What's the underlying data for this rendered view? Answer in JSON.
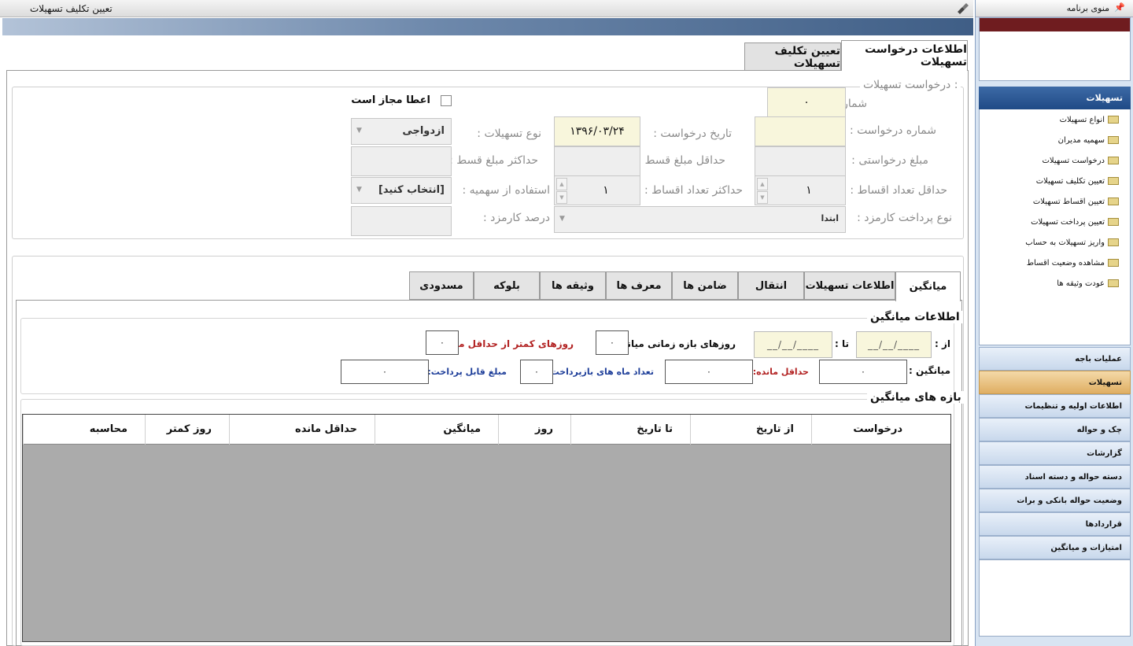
{
  "window": {
    "title": "تعیین تکلیف تسهیلات"
  },
  "outer_tabs": [
    "اطلاعات درخواست تسهیلات",
    "تعیین تکلیف تسهیلات"
  ],
  "request": {
    "group_title": "درخواست تسهیلات :",
    "grant_allowed_label": "اعطا مجاز است",
    "account_number_label": "شماره حساب :",
    "account_number_value": "۰",
    "request_number_label": "شماره درخواست :",
    "request_date_label": "تاریخ درخواست :",
    "request_date_value": "۱۳۹۶/۰۳/۲۴",
    "facility_type_label": "نوع تسهیلات :",
    "facility_type_value": "ازدواجی",
    "requested_amount_label": "مبلغ درخواستی :",
    "min_installment_label": "حداقل مبلغ قسط :",
    "max_installment_label": "حداکثر مبلغ قسط :",
    "min_count_label": "حداقل تعداد اقساط :",
    "min_count_value": "۱",
    "max_count_label": "حداکثر تعداد اقساط :",
    "max_count_value": "۱",
    "quota_label": "استفاده از سهمیه :",
    "quota_value": "[انتخاب کنید]",
    "fee_payment_label": "نوع پرداخت کارمزد :",
    "fee_payment_value": "ابتدا",
    "fee_percent_label": "درصد کارمزد :"
  },
  "inner_tabs": [
    "میانگین",
    "اطلاعات تسهیلات",
    "انتقال",
    "ضامن ها",
    "معرف ها",
    "وثیقه ها",
    "بلوکه",
    "مسدودی"
  ],
  "average": {
    "group_title": "اطلاعات میانگین",
    "from_label": "از :",
    "from_value": "__/__/____",
    "to_label": "تا :",
    "to_value": "__/__/____",
    "period_days_label": "روزهای بازه زمانی میانگین:",
    "period_days_value": "۰",
    "days_below_label": "روزهای کمتر از حداقل مانده:",
    "days_below_value": "۰",
    "average_label": "میانگین :",
    "average_value": "۰",
    "min_balance_label": "حداقل مانده:",
    "min_balance_value": "۰",
    "months_label": "تعداد ماه های بازپرداخت:",
    "months_value": "۰",
    "payable_label": "مبلغ قابل پرداخت:",
    "payable_value": "۰"
  },
  "ranges": {
    "group_title": "بازه های میانگین",
    "columns": [
      "درخواست",
      "از تاریخ",
      "تا تاریخ",
      "روز",
      "میانگین",
      "حداقل مانده",
      "روز کمتر",
      "محاسبه"
    ]
  },
  "nav": {
    "title": "منوی برنامه",
    "section_title": "تسهیلات",
    "tree": [
      "انواع تسهیلات",
      "سهمیه مدیران",
      "درخواست تسهیلات",
      "تعیین تکلیف تسهیلات",
      "تعیین اقساط تسهیلات",
      "تعیین پرداخت تسهیلات",
      "واریز تسهیلات به حساب",
      "مشاهده وضعیت اقساط",
      "عودت وثیقه ها"
    ],
    "buttons": [
      "عملیات باجه",
      "تسهیلات",
      "اطلاعات اولیه و تنظیمات",
      "چک و حواله",
      "گزارشات",
      "دسته حواله و دسته اسناد",
      "وضعیت حواله بانکی و برات",
      "قراردادها",
      "امتیازات و میانگین"
    ]
  },
  "colors": {
    "accent": "#3f5e86",
    "nav_selected": "#dfae62",
    "red_label": "#b22222",
    "blue_label": "#1f3f9a"
  }
}
